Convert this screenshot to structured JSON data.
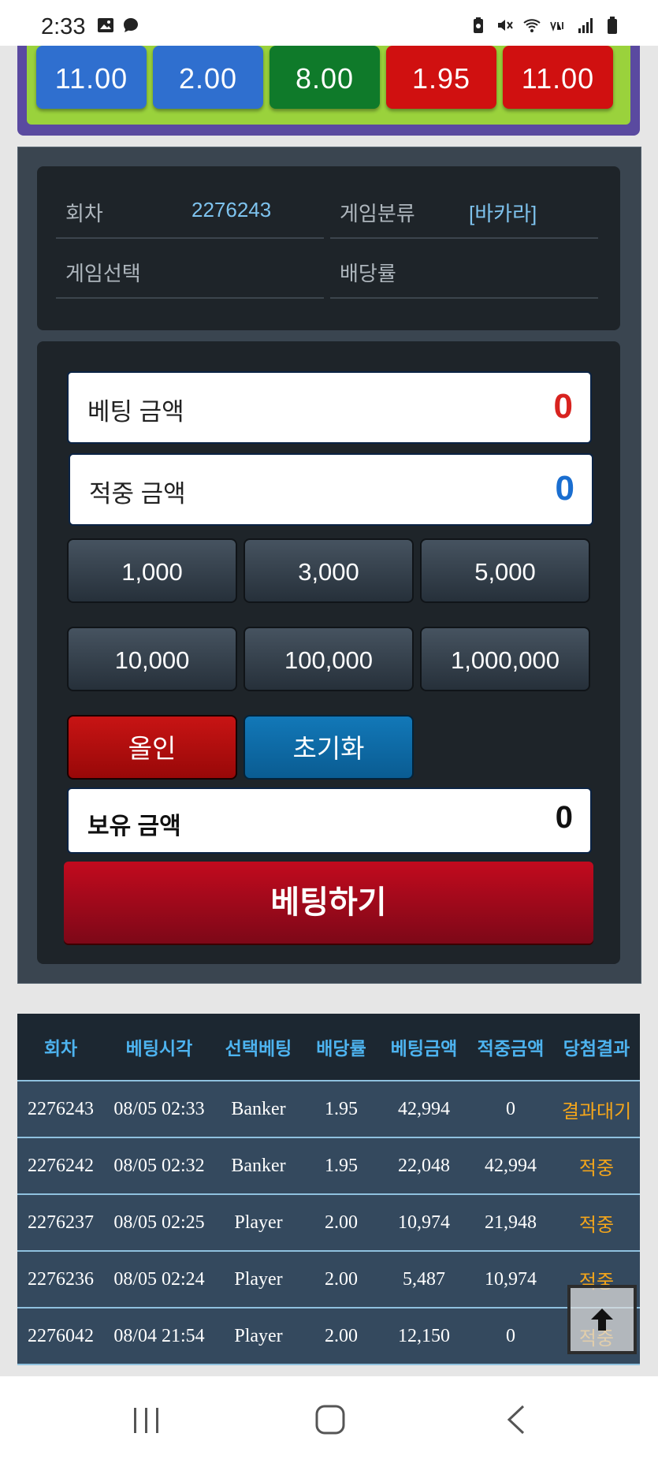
{
  "status_bar": {
    "time": "2:33"
  },
  "odds": [
    {
      "value": "11.00",
      "color": "#2f6fcf"
    },
    {
      "value": "2.00",
      "color": "#2f6fcf"
    },
    {
      "value": "8.00",
      "color": "#0f7a2a"
    },
    {
      "value": "1.95",
      "color": "#d01010"
    },
    {
      "value": "11.00",
      "color": "#d01010"
    }
  ],
  "info": {
    "round_label": "회차",
    "round_value": "2276243",
    "category_label": "게임분류",
    "category_value": "[바카라]",
    "selection_label": "게임선택",
    "odds_label": "배당률"
  },
  "calc": {
    "bet_amount_label": "베팅 금액",
    "bet_amount_value": "0",
    "win_amount_label": "적중 금액",
    "win_amount_value": "0",
    "chips": [
      "1,000",
      "3,000",
      "5,000",
      "10,000",
      "100,000",
      "1,000,000"
    ],
    "allin_label": "올인",
    "reset_label": "초기화",
    "holding_label": "보유 금액",
    "holding_value": "0",
    "submit_label": "베팅하기"
  },
  "history": {
    "headers": [
      "회차",
      "베팅시각",
      "선택베팅",
      "배당률",
      "베팅금액",
      "적중금액",
      "당첨결과"
    ],
    "rows": [
      [
        "2276243",
        "08/05 02:33",
        "Banker",
        "1.95",
        "42,994",
        "0",
        "결과대기"
      ],
      [
        "2276242",
        "08/05 02:32",
        "Banker",
        "1.95",
        "22,048",
        "42,994",
        "적중"
      ],
      [
        "2276237",
        "08/05 02:25",
        "Player",
        "2.00",
        "10,974",
        "21,948",
        "적중"
      ],
      [
        "2276236",
        "08/05 02:24",
        "Player",
        "2.00",
        "5,487",
        "10,974",
        "적중"
      ],
      [
        "2276042",
        "08/04 21:54",
        "Player",
        "2.00",
        "12,150",
        "0",
        "적중"
      ]
    ]
  },
  "colors": {
    "bet_amount": "#d8231f",
    "win_amount": "#1a6ed0",
    "result": "#f3a51b"
  }
}
